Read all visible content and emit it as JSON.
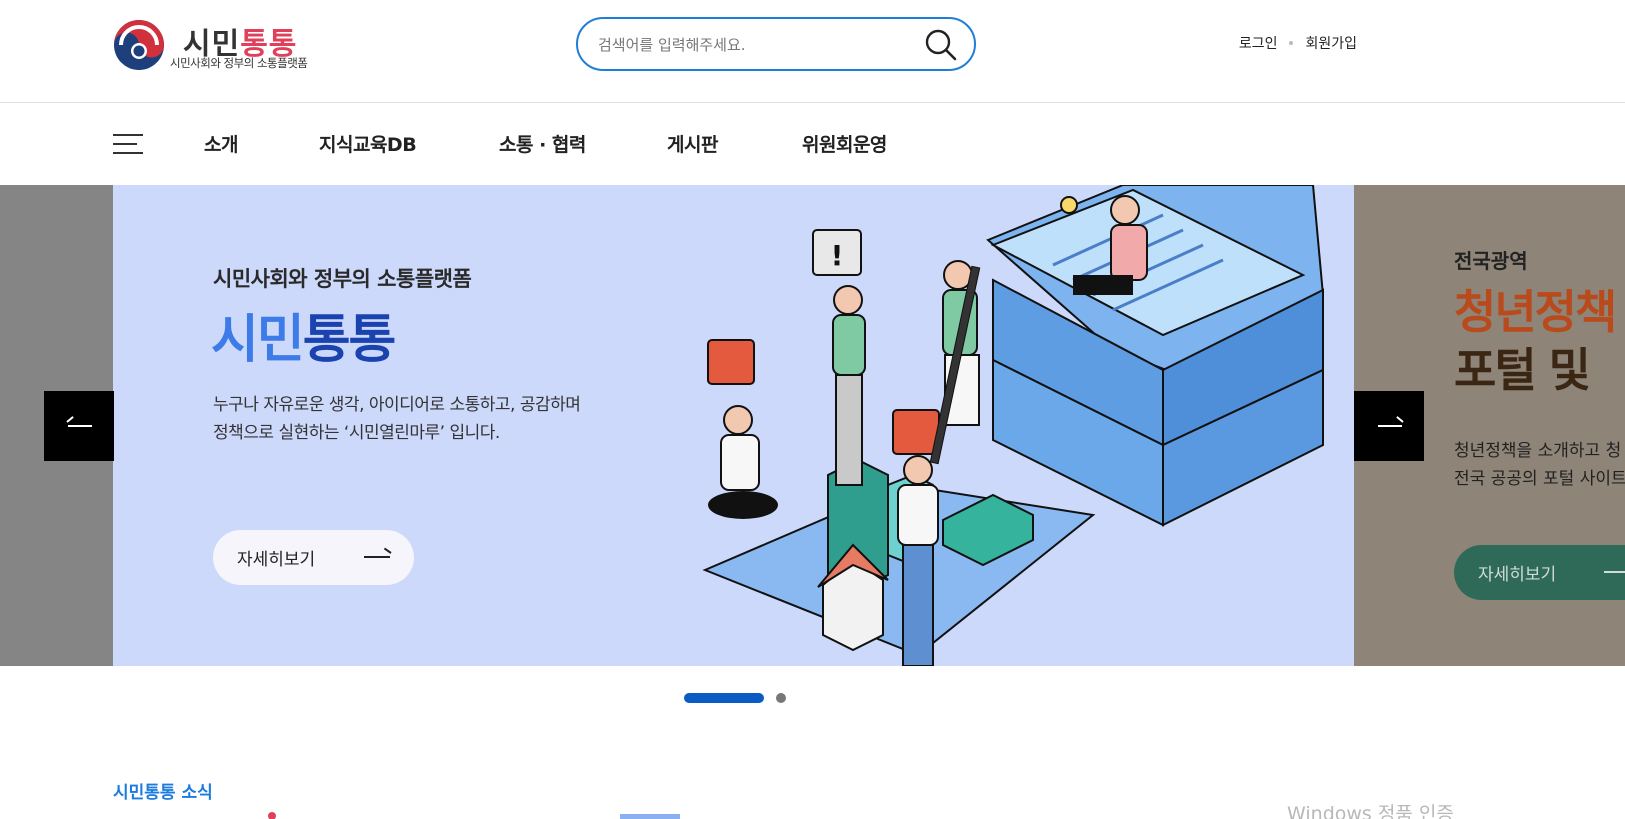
{
  "header": {
    "logo_title_part1": "시민",
    "logo_title_part2": "통통",
    "logo_subtitle": "시민사회와 정부의 소통플랫폼",
    "search_placeholder": "검색어를 입력해주세요.",
    "login_label": "로그인",
    "signup_label": "회원가입"
  },
  "nav": {
    "menu_icon": "hamburger-menu-icon",
    "items": [
      {
        "label": "소개"
      },
      {
        "label": "지식교육DB"
      },
      {
        "label": "소통 · 협력"
      },
      {
        "label": "게시판"
      },
      {
        "label": "위원회운영"
      }
    ]
  },
  "banner": {
    "current": {
      "subtitle": "시민사회와 정부의 소통플랫폼",
      "title_part1": "시민",
      "title_part2": "통통",
      "desc_line1": "누구나 자유로운 생각, 아이디어로 소통하고, 공감하며",
      "desc_line2": "정책으로 실현하는 ‘시민열린마루’ 입니다.",
      "button_label": "자세히보기",
      "background": "#ccd9fb"
    },
    "next": {
      "label": "전국광역",
      "title_line1": "청년정책",
      "title_line2": "포털 및",
      "desc_line1": "청년정책을 소개하고 청",
      "desc_line2": "전국 공공의 포털 사이트",
      "button_label": "자세히보기",
      "background": "#8e8478"
    },
    "prev_icon": "arrow-left-icon",
    "next_icon": "arrow-right-icon",
    "pagination": {
      "total": 2,
      "active": 1
    }
  },
  "news": {
    "section_title": "시민통통 소식"
  },
  "watermark": "Windows 정품 인증",
  "colors": {
    "accent_blue": "#1f7ed6",
    "brand_red": "#e0405b",
    "title_blue": "#1a43b0",
    "pager_active": "#0a5cc4"
  }
}
